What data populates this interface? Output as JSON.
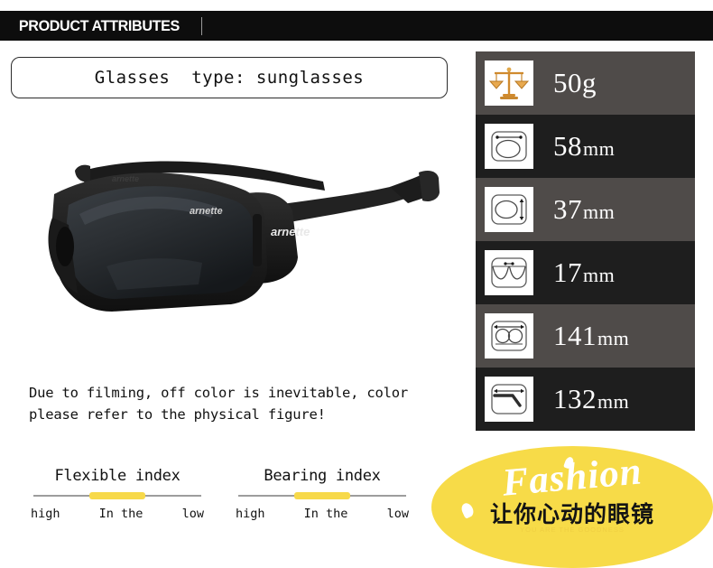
{
  "header": {
    "title": "PRODUCT ATTRIBUTES"
  },
  "product": {
    "title": "Glasses  type: sunglasses",
    "photo_alt": "black-wraparound-sunglasses",
    "brand_mark": "arnette"
  },
  "disclaimer": {
    "line1": "Due to filming, off color is inevitable, color",
    "line2": "please refer to the physical figure!"
  },
  "indices": [
    {
      "name": "flexible",
      "title": "Flexible index",
      "labels": {
        "left": "high",
        "center": "In the",
        "right": "low"
      },
      "fill_color": "#f7d94a",
      "rail_color": "#9d9d9d"
    },
    {
      "name": "bearing",
      "title": "Bearing index",
      "labels": {
        "left": "high",
        "center": "In the",
        "right": "low"
      },
      "fill_color": "#f7d94a",
      "rail_color": "#9d9d9d"
    }
  ],
  "specs": {
    "row_colors": {
      "light": "#4f4b49",
      "dark": "#1e1e1e"
    },
    "rows": [
      {
        "icon": "balance-scale-icon",
        "value": "50",
        "unit": "g",
        "unit_small": false
      },
      {
        "icon": "lens-width-icon",
        "value": "58",
        "unit": "mm",
        "unit_small": true
      },
      {
        "icon": "lens-height-icon",
        "value": "37",
        "unit": "mm",
        "unit_small": true
      },
      {
        "icon": "bridge-width-icon",
        "value": "17",
        "unit": "mm",
        "unit_small": true
      },
      {
        "icon": "frame-width-icon",
        "value": "141",
        "unit": "mm",
        "unit_small": true
      },
      {
        "icon": "temple-length-icon",
        "value": "132",
        "unit": "mm",
        "unit_small": true
      }
    ]
  },
  "badge": {
    "fashion_text": "Fashion",
    "chinese_text": "让你心动的眼镜",
    "sub_text": "YOU ARE THE GOODNESS",
    "background_color": "#f7db48"
  }
}
